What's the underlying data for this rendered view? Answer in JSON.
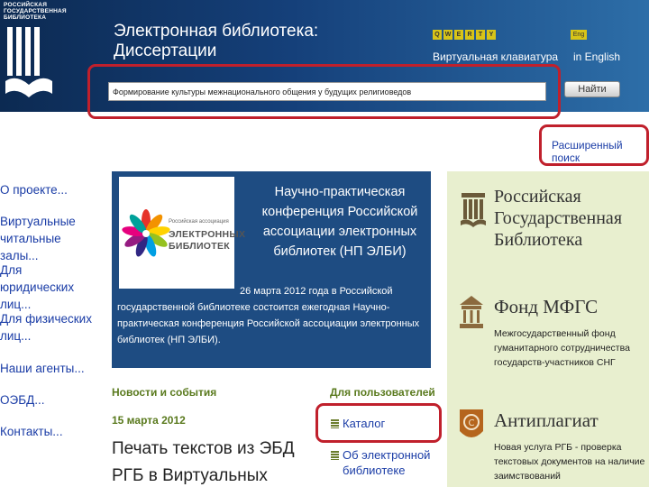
{
  "header": {
    "logo_lines": [
      "РОССИЙСКАЯ",
      "ГОСУДАРСТВЕННАЯ",
      "БИБЛИОТЕКА"
    ],
    "title_line1": "Электронная библиотека:",
    "title_line2": "Диссертации",
    "keyboard_keys": [
      "Q",
      "W",
      "E",
      "R",
      "T",
      "Y"
    ],
    "keyboard_label": "Виртуальная клавиатура",
    "english_badge": "Eng",
    "english_label": "in English"
  },
  "search": {
    "value": "Формирование культуры межнационального общения у будущих религиоведов",
    "button_label": "Найти"
  },
  "advanced_search": "Расширенный поиск",
  "nav": [
    "О проекте...",
    "Виртуальные\nчитальные залы...",
    "Для юридических\nлиц...",
    "Для физических\nлиц...",
    "Наши агенты...",
    "ОЭБД...",
    "Контакты..."
  ],
  "banner": {
    "logo_assoc": "Российская ассоциация",
    "logo_line1": "ЭЛЕКТРОННЫХ",
    "logo_line2": "БИБЛИОТЕК",
    "headline": "Научно-практическая конференция Российской ассоциации электронных библиотек (НП ЭЛБИ)",
    "body": "26 марта 2012 года в Российской государственной библиотеке состоится ежегодная Научно-практическая конференция Российской ассоциации электронных библиотек (НП ЭЛБИ)."
  },
  "news": {
    "title": "Новости и события",
    "date": "15 марта 2012",
    "headline": "Печать текстов из ЭБД РГБ в Виртуальных"
  },
  "users": {
    "title": "Для пользователей",
    "links": [
      "Каталог",
      "Об электронной\nбиблиотеке"
    ]
  },
  "partners": {
    "rgb_title": "Российская\nГосударственная\nБиблиотека",
    "mfgs_title": "Фонд МФГС",
    "mfgs_desc": "Межгосударственный фонд гуманитарного сотрудничества государств-участников СНГ",
    "anti_title": "Антиплагиат",
    "anti_desc": "Новая услуга РГБ - проверка текстовых документов на наличие заимствований"
  },
  "colors": {
    "header_dark": "#0c2a52",
    "highlight_red": "#c0202c",
    "link_blue": "#1a3ca6",
    "section_green": "#5a7a1e",
    "sidebar_bg": "#e8efcf"
  }
}
